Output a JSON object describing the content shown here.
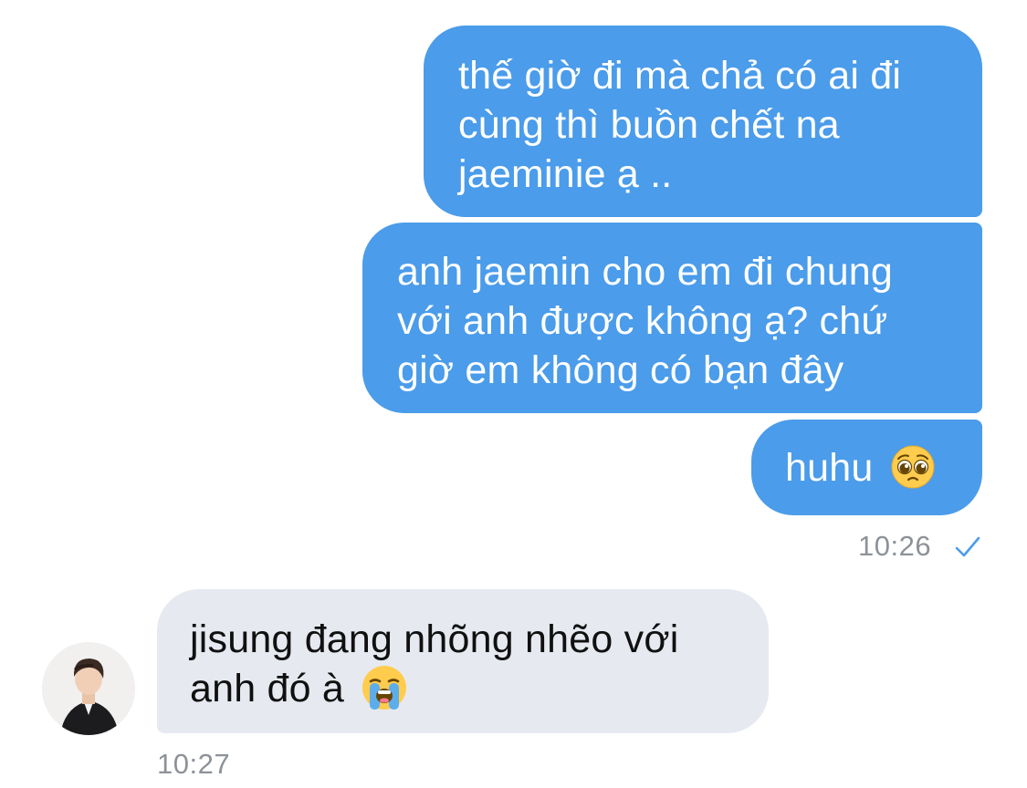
{
  "messages": [
    {
      "direction": "sent",
      "lines": [
        "thế giờ đi mà chả có ai đi",
        "cùng thì buồn chết na",
        "jaeminie ạ .."
      ]
    },
    {
      "direction": "sent",
      "lines": [
        "anh jaemin cho em đi chung",
        "với anh được không ạ? chứ",
        "giờ em không có bạn đây"
      ]
    },
    {
      "direction": "sent",
      "text": "huhu",
      "emoji": "pleading-face-emoji"
    },
    {
      "direction": "received",
      "lines": [
        "jisung đang nhõng nhẽo với",
        "anh đó à"
      ],
      "emoji": "loudly-crying-face-emoji"
    }
  ],
  "sent_group": {
    "time": "10:26",
    "status_icon": "single-check-icon",
    "check_color": "#4b9cea"
  },
  "received_group": {
    "time": "10:27",
    "avatar": "contact-avatar-photo"
  },
  "colors": {
    "sent_bubble": "#4b9cea",
    "received_bubble": "#e6e9f0",
    "timestamp": "#8d9298"
  }
}
